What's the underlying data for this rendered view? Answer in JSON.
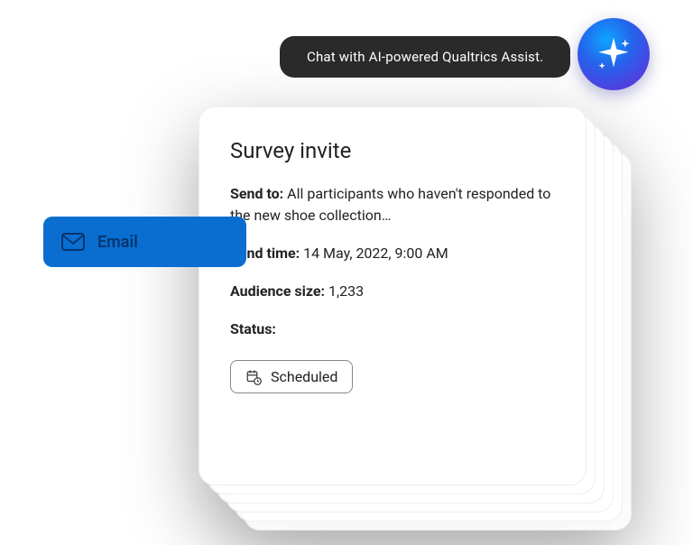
{
  "assist": {
    "text": "Chat with AI-powered Qualtrics Assist."
  },
  "sidebar": {
    "email_label": "Email"
  },
  "card": {
    "title": "Survey invite",
    "send_to_label": "Send to:",
    "send_to_value": "All participants who haven't responded to the new shoe collection…",
    "send_time_label": "Send time:",
    "send_time_value": "14 May, 2022, 9:00 AM",
    "audience_size_label": "Audience size:",
    "audience_size_value": "1,233",
    "status_label": "Status:",
    "status_value": "Scheduled"
  }
}
